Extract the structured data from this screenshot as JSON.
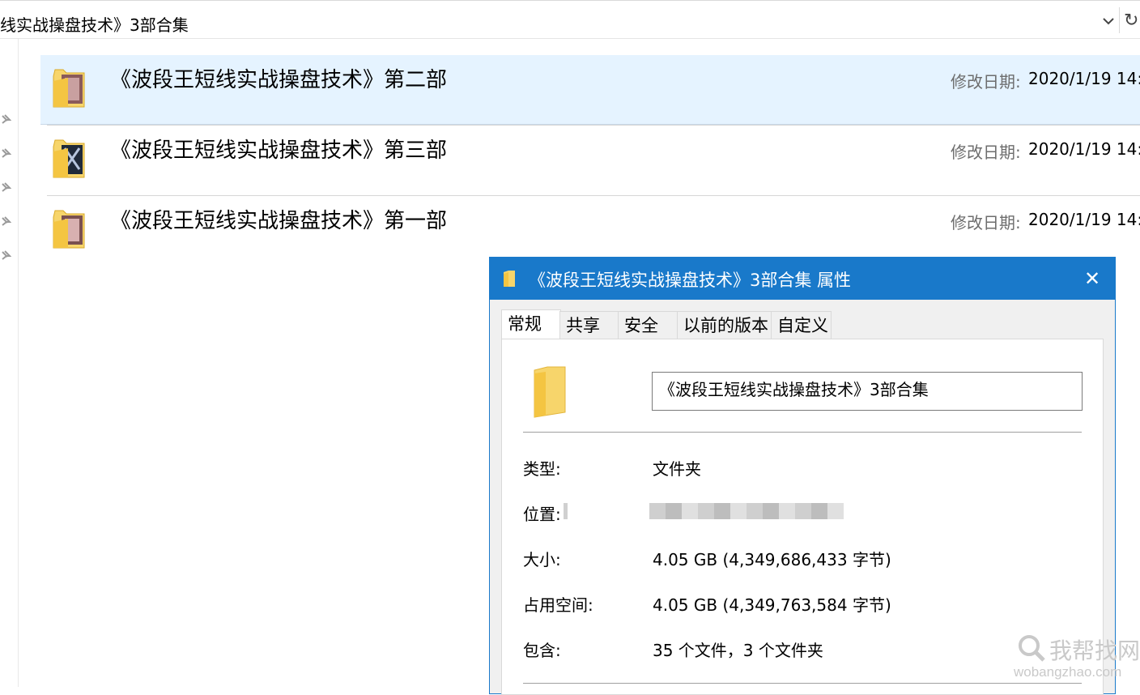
{
  "address_bar": {
    "path": "线实战操盘技术》3部合集",
    "refresh_glyph": "↻"
  },
  "files": [
    {
      "name": "《波段王短线实战操盘技术》第二部",
      "date_label": "修改日期:",
      "date": "2020/1/19 14:",
      "selected": true
    },
    {
      "name": "《波段王短线实战操盘技术》第三部",
      "date_label": "修改日期:",
      "date": "2020/1/19 14:",
      "selected": false
    },
    {
      "name": "《波段王短线实战操盘技术》第一部",
      "date_label": "修改日期:",
      "date": "2020/1/19 14:",
      "selected": false
    }
  ],
  "dialog": {
    "title": "《波段王短线实战操盘技术》3部合集 属性",
    "close_glyph": "✕",
    "tabs": [
      "常规",
      "共享",
      "安全",
      "以前的版本",
      "自定义"
    ],
    "active_tab": "常规",
    "folder_name": "《波段王短线实战操盘技术》3部合集",
    "props": {
      "type_label": "类型:",
      "type_value": "文件夹",
      "location_label": "位置:",
      "size_label": "大小:",
      "size_value": "4.05 GB (4,349,686,433 字节)",
      "disk_label": "占用空间:",
      "disk_value": "4.05 GB (4,349,763,584 字节)",
      "contains_label": "包含:",
      "contains_value": "35 个文件，3 个文件夹"
    }
  },
  "watermark": {
    "text": "我帮找网",
    "url": "wobangzhao.com"
  },
  "colors": {
    "title_bar": "#1979ca",
    "selection": "#e5f3ff",
    "folder_yellow": "#f7d56b"
  }
}
